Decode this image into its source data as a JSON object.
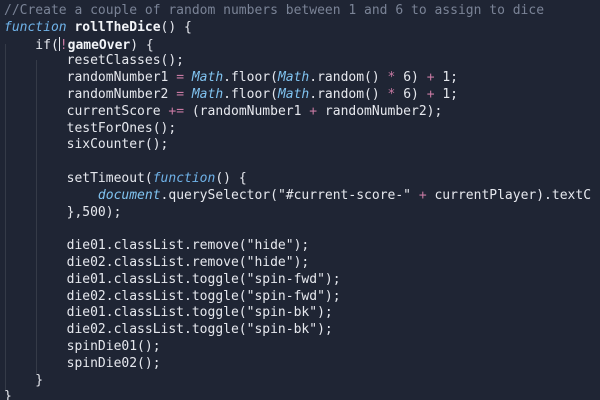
{
  "colors": {
    "background": "#1f2534",
    "comment": "#7a8396",
    "keyword": "#6fb2e8",
    "builtin_object": "#80c3f0",
    "operator": "#c97aa4",
    "text": "#e6e8ee"
  },
  "code": {
    "lines": [
      [
        {
          "t": "//Create a couple of random numbers between 1 and 6 to assign to dice",
          "c": "comment"
        }
      ],
      [
        {
          "t": "function",
          "c": "kw"
        },
        {
          "t": " "
        },
        {
          "t": "rollTheDice",
          "c": "fn"
        },
        {
          "t": "() {"
        }
      ],
      [
        {
          "t": "    if("
        },
        {
          "t": "!",
          "c": "op"
        },
        {
          "t": "gameOver",
          "c": "fn"
        },
        {
          "t": ") {"
        }
      ],
      [
        {
          "t": "        resetClasses();"
        }
      ],
      [
        {
          "t": "        randomNumber1 "
        },
        {
          "t": "=",
          "c": "op"
        },
        {
          "t": " "
        },
        {
          "t": "Math",
          "c": "obj"
        },
        {
          "t": ".floor("
        },
        {
          "t": "Math",
          "c": "obj"
        },
        {
          "t": ".random() "
        },
        {
          "t": "*",
          "c": "op"
        },
        {
          "t": " 6) "
        },
        {
          "t": "+",
          "c": "op"
        },
        {
          "t": " 1;"
        }
      ],
      [
        {
          "t": "        randomNumber2 "
        },
        {
          "t": "=",
          "c": "op"
        },
        {
          "t": " "
        },
        {
          "t": "Math",
          "c": "obj"
        },
        {
          "t": ".floor("
        },
        {
          "t": "Math",
          "c": "obj"
        },
        {
          "t": ".random() "
        },
        {
          "t": "*",
          "c": "op"
        },
        {
          "t": " 6) "
        },
        {
          "t": "+",
          "c": "op"
        },
        {
          "t": " 1;"
        }
      ],
      [
        {
          "t": "        currentScore "
        },
        {
          "t": "+=",
          "c": "op"
        },
        {
          "t": " (randomNumber1 "
        },
        {
          "t": "+",
          "c": "op"
        },
        {
          "t": " randomNumber2);"
        }
      ],
      [
        {
          "t": "        testForOnes();"
        }
      ],
      [
        {
          "t": "        sixCounter();"
        }
      ],
      [
        {
          "t": ""
        }
      ],
      [
        {
          "t": "        setTimeout("
        },
        {
          "t": "function",
          "c": "kw"
        },
        {
          "t": "() {"
        }
      ],
      [
        {
          "t": "            "
        },
        {
          "t": "document",
          "c": "obj"
        },
        {
          "t": ".querySelector(\"#current-score-\" "
        },
        {
          "t": "+",
          "c": "op"
        },
        {
          "t": " currentPlayer).textC"
        }
      ],
      [
        {
          "t": "        },500);"
        }
      ],
      [
        {
          "t": ""
        }
      ],
      [
        {
          "t": "        die01.classList.remove(\"hide\");"
        }
      ],
      [
        {
          "t": "        die02.classList.remove(\"hide\");"
        }
      ],
      [
        {
          "t": "        die01.classList.toggle(\"spin-fwd\");"
        }
      ],
      [
        {
          "t": "        die02.classList.toggle(\"spin-fwd\");"
        }
      ],
      [
        {
          "t": "        die01.classList.toggle(\"spin-bk\");"
        }
      ],
      [
        {
          "t": "        die02.classList.toggle(\"spin-bk\");"
        }
      ],
      [
        {
          "t": "        spinDie01();"
        }
      ],
      [
        {
          "t": "        spinDie02();"
        }
      ],
      [
        {
          "t": "    }"
        }
      ],
      [
        {
          "t": "}"
        }
      ]
    ]
  }
}
